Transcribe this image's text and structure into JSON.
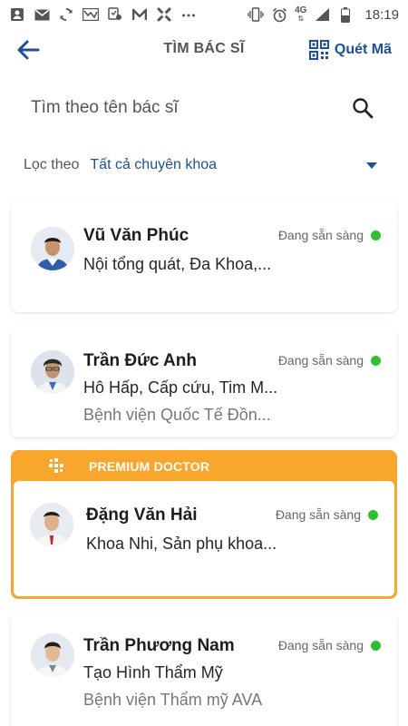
{
  "status_bar": {
    "time": "18:19",
    "network": "4G",
    "left_icons": [
      "account-box-icon",
      "mail-icon",
      "sync-icon",
      "mail-alt-icon",
      "location-check-icon",
      "m-logo-icon",
      "cross-app-icon",
      "more-dots-icon"
    ],
    "right_icons": [
      "vibrate-icon",
      "alarm-icon",
      "network-4g-icon",
      "signal-icon",
      "battery-icon"
    ]
  },
  "header": {
    "title": "TÌM BÁC SĨ",
    "scan_label": "Quét Mã"
  },
  "search": {
    "placeholder": "Tìm theo tên bác sĩ"
  },
  "filter": {
    "label": "Lọc theo",
    "selected": "Tất cả chuyên khoa"
  },
  "colors": {
    "accent": "#1d4f9e",
    "premium": "#f8a62c",
    "status_ready": "#2fc02f"
  },
  "premium_label": "PREMIUM DOCTOR",
  "doctors": [
    {
      "name": "Vũ Văn Phúc",
      "status": "Đang sẵn sàng",
      "specialty": "Nội tổng quát, Đa Khoa,...",
      "hospital": ""
    },
    {
      "name": "Trần Đức Anh",
      "status": "Đang sẵn sàng",
      "specialty": "Hô Hấp, Cấp cứu, Tim M...",
      "hospital": "Bệnh viện Quốc Tế Đồn..."
    },
    {
      "name": "Đặng Văn Hải",
      "status": "Đang sẵn sàng",
      "specialty": "Khoa Nhi, Sản phụ khoa...",
      "hospital": ""
    },
    {
      "name": "Trần Phương Nam",
      "status": "Đang sẵn sàng",
      "specialty": "Tạo Hình Thẩm Mỹ",
      "hospital": "Bệnh viện Thẩm mỹ AVA"
    }
  ]
}
